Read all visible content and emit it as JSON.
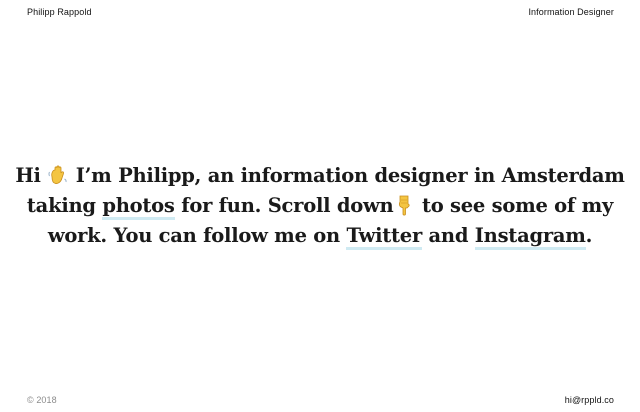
{
  "header": {
    "name": "Philipp Rappold",
    "role": "Information Designer"
  },
  "footer": {
    "copyright": "© 2018",
    "email": "hi@rppld.co"
  },
  "intro": {
    "l1_a": "Hi ",
    "wave_icon": "waving-hand-emoji",
    "l1_b": " I’m Philipp, an information designer in Amsterdam",
    "l2_a": "taking ",
    "photos_link": "photos",
    "l2_b": " for fun. Scroll down",
    "point_icon": "pointing-down-emoji",
    "l2_c": " to see some of my",
    "l3_a": "work. You can follow me on ",
    "twitter_link": "Twitter",
    "l3_b": " and ",
    "instagram_link": "Instagram",
    "l3_c": "."
  },
  "colors": {
    "link_underline": "#cfeaf2",
    "text": "#1a1a1a",
    "muted": "#8c8c8c",
    "emoji": "#f4c542"
  }
}
